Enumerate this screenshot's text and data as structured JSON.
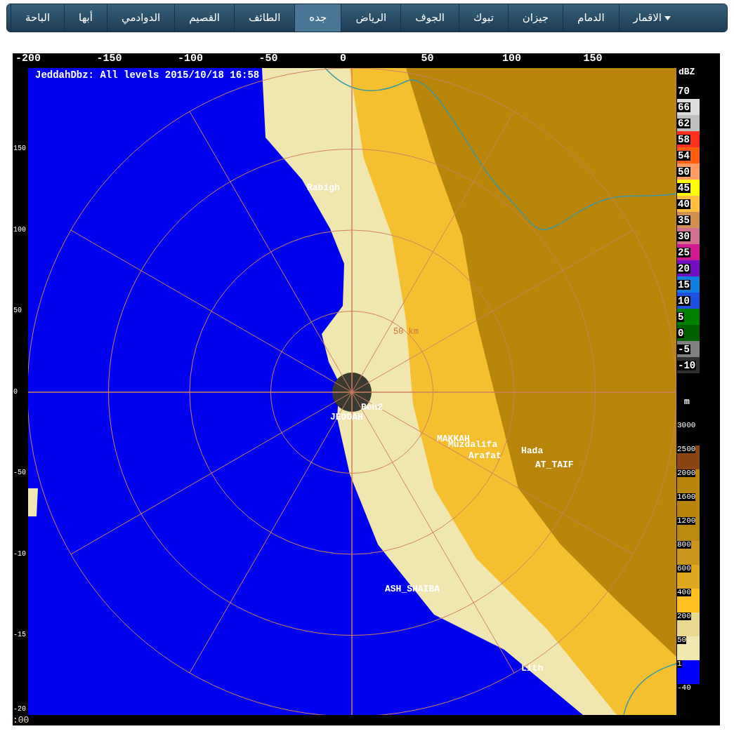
{
  "nav": {
    "items": [
      {
        "label": "الاقمار",
        "kind": "dropdown",
        "selected": false
      },
      {
        "label": "الدمام",
        "kind": "link",
        "selected": false
      },
      {
        "label": "جيزان",
        "kind": "link",
        "selected": false
      },
      {
        "label": "تبوك",
        "kind": "link",
        "selected": false
      },
      {
        "label": "الجوف",
        "kind": "link",
        "selected": false
      },
      {
        "label": "الرياض",
        "kind": "link",
        "selected": false
      },
      {
        "label": "جده",
        "kind": "link",
        "selected": true
      },
      {
        "label": "الطائف",
        "kind": "link",
        "selected": false
      },
      {
        "label": "القصيم",
        "kind": "link",
        "selected": false
      },
      {
        "label": "الدوادمي",
        "kind": "link",
        "selected": false
      },
      {
        "label": "أبها",
        "kind": "link",
        "selected": false
      },
      {
        "label": "الباحة",
        "kind": "link",
        "selected": false
      }
    ]
  },
  "radar": {
    "title": "JeddahDbz: All levels 2015/10/18 16:58",
    "x_ticks": [
      "-200",
      "-150",
      "-100",
      "-50",
      "0",
      "50",
      "100",
      "150"
    ],
    "y_ticks": [
      "150",
      "100",
      "50",
      "0",
      "-50",
      "-10",
      "-15",
      "-20"
    ],
    "corner_text": ":00",
    "range_label": "50 km",
    "places": [
      "Rabigh",
      "Beh2",
      "JEDDAH",
      "MAKKAH",
      "Muzdalifa",
      "Arafat",
      "Hada",
      "AT_TAIF",
      "ASH_SHAIBA",
      "Lith"
    ],
    "dbz_legend": {
      "unit": "dBZ",
      "entries": [
        {
          "label": "70",
          "color": "#000000"
        },
        {
          "label": "66",
          "color": "#dcdcdc"
        },
        {
          "label": "62",
          "color": "#c0c0c0"
        },
        {
          "label": "58",
          "color": "#ff3020"
        },
        {
          "label": "54",
          "color": "#ff6010"
        },
        {
          "label": "50",
          "color": "#ff9a60"
        },
        {
          "label": "45",
          "color": "#ffff00"
        },
        {
          "label": "40",
          "color": "#ffc040"
        },
        {
          "label": "35",
          "color": "#d09050"
        },
        {
          "label": "30",
          "color": "#d07090"
        },
        {
          "label": "25",
          "color": "#d01890"
        },
        {
          "label": "20",
          "color": "#7010c0"
        },
        {
          "label": "15",
          "color": "#1080e0"
        },
        {
          "label": "10",
          "color": "#2050e0"
        },
        {
          "label": "5",
          "color": "#008000"
        },
        {
          "label": "0",
          "color": "#006000"
        },
        {
          "label": "-5",
          "color": "#808080"
        },
        {
          "label": "-10",
          "color": "#303030"
        }
      ]
    },
    "height_legend": {
      "unit": "m",
      "entries": [
        {
          "label": "3000",
          "color": "#000000"
        },
        {
          "label": "2500",
          "color": "#8b4513"
        },
        {
          "label": "2000",
          "color": "#b8860b"
        },
        {
          "label": "1600",
          "color": "#b8860b"
        },
        {
          "label": "1200",
          "color": "#b88a10"
        },
        {
          "label": "800",
          "color": "#c8961a"
        },
        {
          "label": "600",
          "color": "#e0a820"
        },
        {
          "label": "400",
          "color": "#ffc020"
        },
        {
          "label": "200",
          "color": "#e8d890"
        },
        {
          "label": "50",
          "color": "#f0e8b0"
        },
        {
          "label": "1",
          "color": "#0000ff"
        },
        {
          "label": "-40",
          "color": "#000000"
        }
      ]
    }
  }
}
